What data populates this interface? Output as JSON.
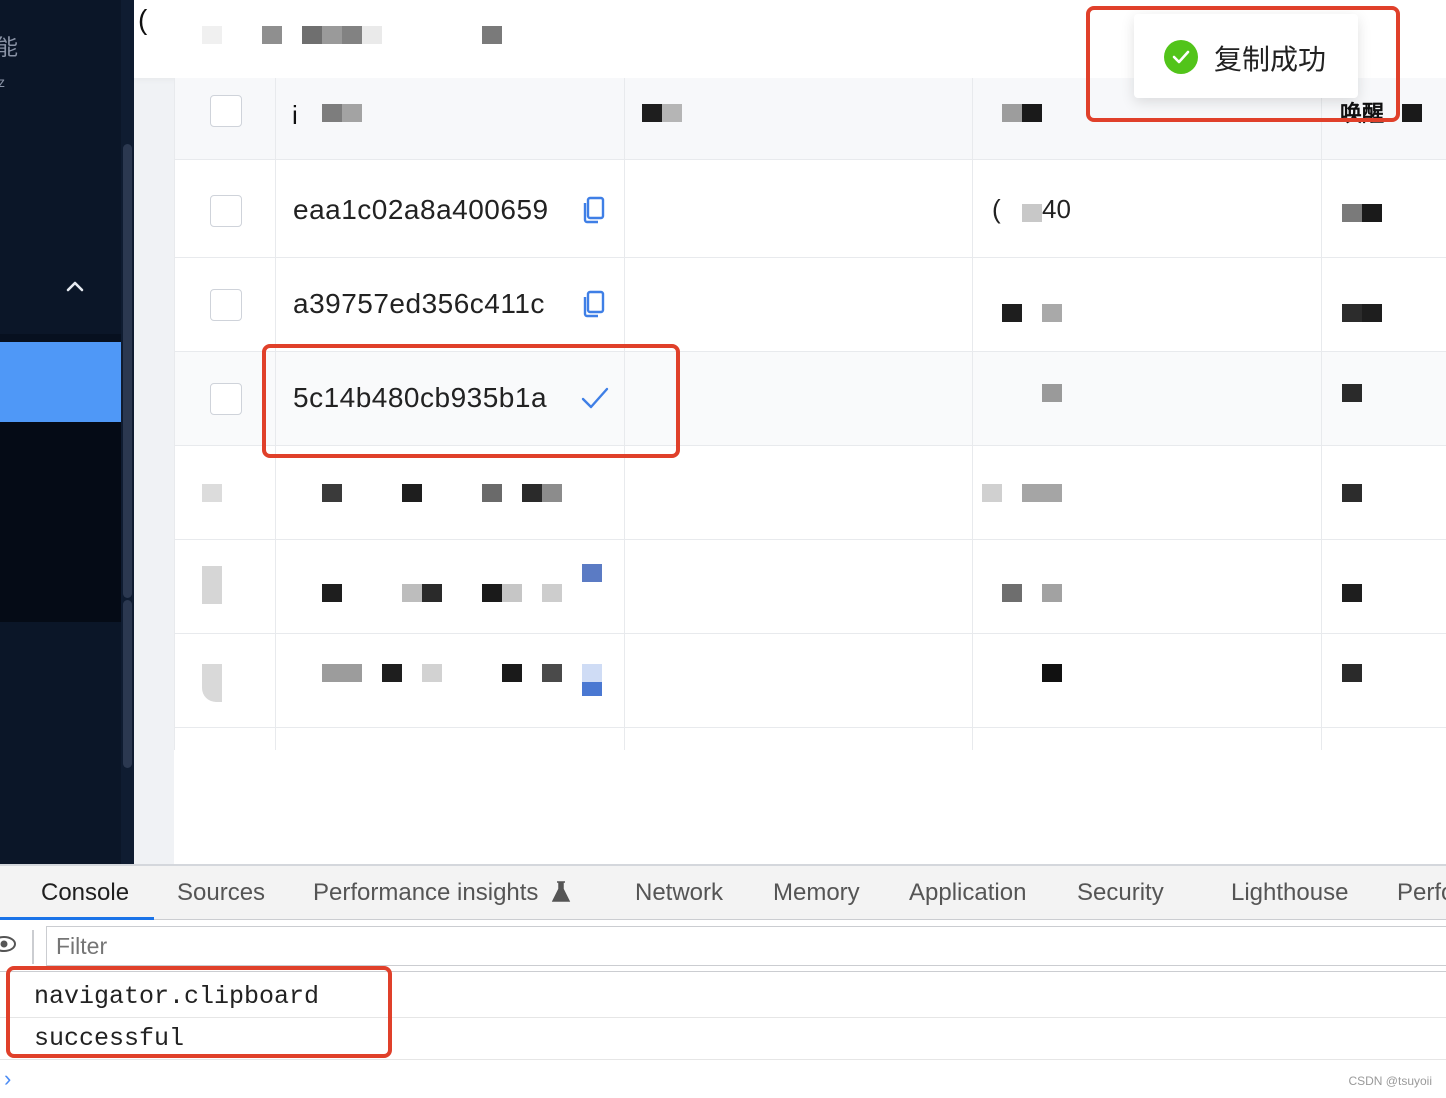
{
  "toast": {
    "message": "复制成功",
    "icon": "check-circle-icon",
    "color": "#52c41a"
  },
  "header": {
    "lead_glyph": "("
  },
  "table": {
    "header": {
      "first_col_glyph": "i",
      "wake_col_label": "唤醒"
    },
    "rows": [
      {
        "id": "eaa1c02a8a400659",
        "action_icon": "copy-icon",
        "col3_partial": "40",
        "col3_prefix": "("
      },
      {
        "id": "a39757ed356c411c",
        "action_icon": "copy-icon"
      },
      {
        "id": "5c14b480cb935b1a",
        "action_icon": "check-icon"
      }
    ]
  },
  "devtools": {
    "tabs": [
      "Console",
      "Sources",
      "Performance insights",
      "Network",
      "Memory",
      "Application",
      "Security",
      "Lighthouse",
      "Perfo"
    ],
    "active_tab": "Console",
    "filter_placeholder": "Filter",
    "console_lines": [
      "navigator.clipboard",
      "successful"
    ],
    "prompt": "›"
  },
  "watermark": "CSDN @tsuyoii",
  "colors": {
    "accent": "#1a73e8",
    "sidebar_active": "#4f98f7",
    "highlight_border": "#e0402a",
    "copy_icon": "#3f7fe6"
  }
}
